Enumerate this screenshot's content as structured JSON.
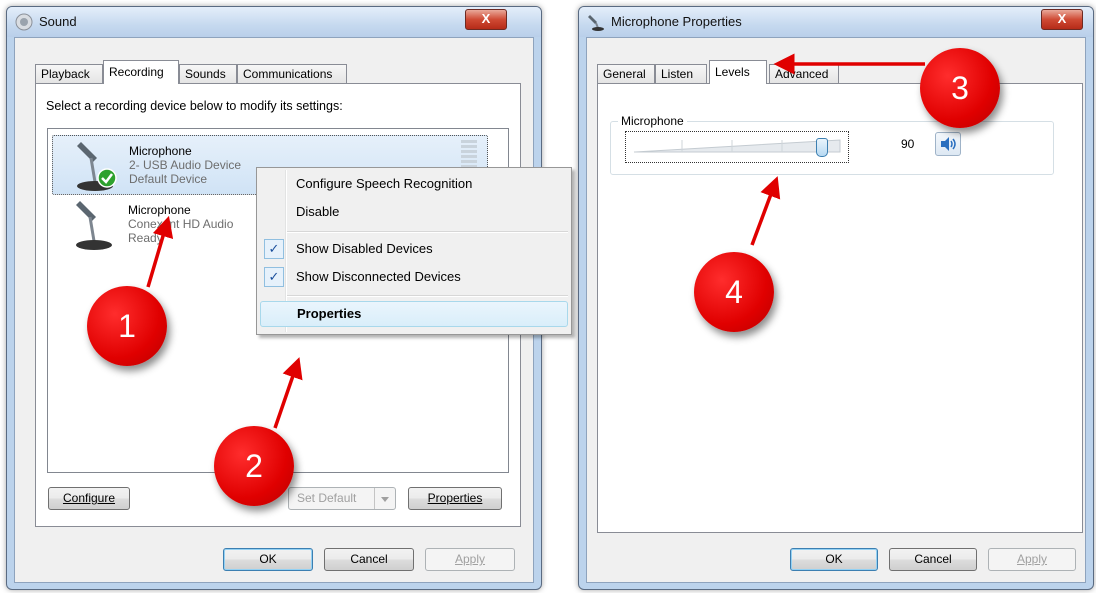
{
  "sound": {
    "title": "Sound",
    "close": "X",
    "tabs": [
      "Playback",
      "Recording",
      "Sounds",
      "Communications"
    ],
    "instruction": "Select a recording device below to modify its settings:",
    "devices": [
      {
        "name": "Microphone",
        "line1": "2- USB Audio Device",
        "line2": "Default Device"
      },
      {
        "name": "Microphone",
        "line1": "Conexant HD Audio",
        "line2": "Ready"
      }
    ],
    "buttons": {
      "configure": "Configure",
      "set_default": "Set Default",
      "properties": "Properties",
      "ok": "OK",
      "cancel": "Cancel",
      "apply": "Apply"
    }
  },
  "context_menu": {
    "items": [
      "Configure Speech Recognition",
      "Disable",
      "Show Disabled Devices",
      "Show Disconnected Devices",
      "Properties"
    ],
    "check": "✓"
  },
  "mic_props": {
    "title": "Microphone Properties",
    "close": "X",
    "tabs": [
      "General",
      "Listen",
      "Levels",
      "Advanced"
    ],
    "group_label": "Microphone",
    "level": 90,
    "level_text": "90",
    "buttons": {
      "ok": "OK",
      "cancel": "Cancel",
      "apply": "Apply"
    }
  },
  "markers": [
    "1",
    "2",
    "3",
    "4"
  ],
  "colors": {
    "marker": "#e00000",
    "arrow": "#e00000"
  }
}
